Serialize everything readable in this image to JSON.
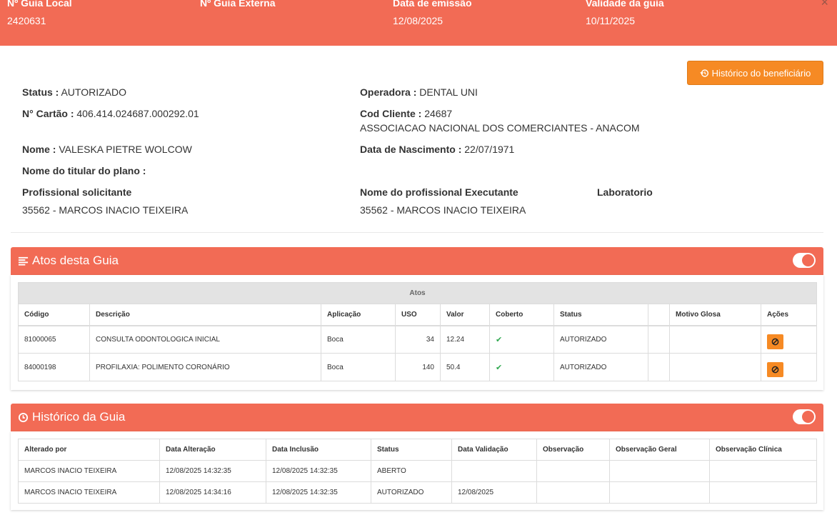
{
  "header": {
    "guia_local_label": "Nº Guia Local",
    "guia_local_value": "2420631",
    "guia_externa_label": "Nº Guia Externa",
    "guia_externa_value": "",
    "data_emissao_label": "Data de emissão",
    "data_emissao_value": "12/08/2025",
    "validade_label": "Validade da guia",
    "validade_value": "10/11/2025",
    "close_glyph": "×"
  },
  "historico_button_label": "Histórico do beneficiário",
  "info": {
    "status_label": "Status :",
    "status_value": "AUTORIZADO",
    "operadora_label": "Operadora :",
    "operadora_value": "DENTAL UNI",
    "cartao_label": "N° Cartão :",
    "cartao_value": "406.414.024687.000292.01",
    "cod_cliente_label": "Cod Cliente :",
    "cod_cliente_value": "24687",
    "cliente_nome": "ASSOCIACAO NACIONAL DOS COMERCIANTES - ANACOM",
    "nome_label": "Nome :",
    "nome_value": "VALESKA PIETRE WOLCOW",
    "nascimento_label": "Data de Nascimento :",
    "nascimento_value": "22/07/1971",
    "titular_label": "Nome do titular do plano :",
    "titular_value": "",
    "prof_solicitante_label": "Profissional solicitante",
    "prof_solicitante_value": "35562 - MARCOS INACIO TEIXEIRA",
    "prof_executante_label": "Nome do profissional Executante",
    "prof_executante_value": "35562 - MARCOS INACIO TEIXEIRA",
    "laboratorio_label": "Laboratorio"
  },
  "atos_panel": {
    "title": "Atos desta Guia",
    "group_header": "Atos",
    "columns": [
      "Código",
      "Descrição",
      "Aplicação",
      "USO",
      "Valor",
      "Coberto",
      "Status",
      "",
      "Motivo Glosa",
      "Ações"
    ],
    "rows": [
      {
        "codigo": "81000065",
        "descricao": "CONSULTA ODONTOLOGICA INICIAL",
        "aplicacao": "Boca",
        "uso": "34",
        "valor": "12.24",
        "coberto": "✔",
        "status": "AUTORIZADO",
        "extra": "",
        "motivo": ""
      },
      {
        "codigo": "84000198",
        "descricao": "PROFILAXIA: POLIMENTO CORONÁRIO",
        "aplicacao": "Boca",
        "uso": "140",
        "valor": "50.4",
        "coberto": "✔",
        "status": "AUTORIZADO",
        "extra": "",
        "motivo": ""
      }
    ]
  },
  "historico_panel": {
    "title": "Histórico da Guia",
    "columns": [
      "Alterado por",
      "Data Alteração",
      "Data Inclusão",
      "Status",
      "Data Validação",
      "Observação",
      "Observação Geral",
      "Observação Clínica"
    ],
    "rows": [
      {
        "alterado_por": "MARCOS INACIO TEIXEIRA",
        "data_alteracao": "12/08/2025 14:32:35",
        "data_inclusao": "12/08/2025 14:32:35",
        "status": "ABERTO",
        "data_validacao": "",
        "obs": "",
        "obs_geral": "",
        "obs_clinica": ""
      },
      {
        "alterado_por": "MARCOS INACIO TEIXEIRA",
        "data_alteracao": "12/08/2025 14:34:16",
        "data_inclusao": "12/08/2025 14:32:35",
        "status": "AUTORIZADO",
        "data_validacao": "12/08/2025",
        "obs": "",
        "obs_geral": "",
        "obs_clinica": ""
      }
    ]
  },
  "colors": {
    "header_bg": "#f26b55",
    "button_orange": "#f68a24",
    "check_green": "#2fa84f"
  },
  "icons": [
    "history-icon",
    "list-icon",
    "clock-icon",
    "ban-icon",
    "close-icon",
    "check-icon"
  ]
}
